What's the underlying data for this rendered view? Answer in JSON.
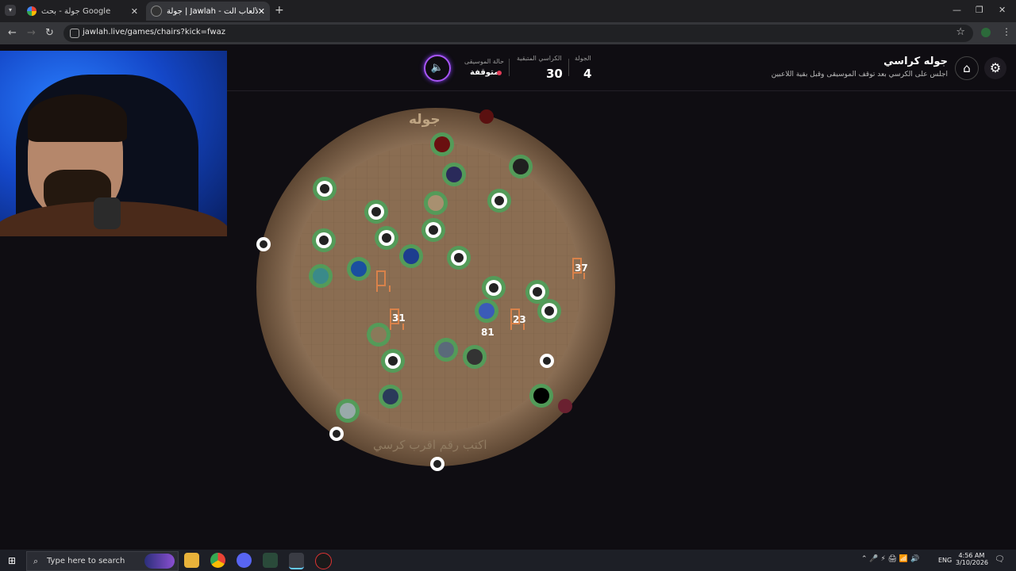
{
  "browser": {
    "tabs": [
      {
        "title": "جولة - بحث Google",
        "active": false
      },
      {
        "title": "جولة | Jawlah - منصة الألعاب الت...",
        "active": true
      }
    ],
    "url": "jawlah.live/games/chairs?kick=fwaz"
  },
  "header": {
    "title": "جوله كراسي",
    "subtitle": "اجلس على الكرسي بعد توقف الموسيقى وقبل بقية اللاعبين",
    "round_label": "الجولة",
    "round_value": "4",
    "remaining_label": "الكراسي المتبقية",
    "remaining_value": "30",
    "music_label": "حالة الموسيقى",
    "music_value": "متوقفة"
  },
  "board": {
    "title": "جوله",
    "prompt": "اكتب رقم اقرب كرسي",
    "chair_numbers": [
      "37",
      "31",
      "23",
      "81"
    ]
  },
  "taskbar": {
    "search_placeholder": "Type here to search",
    "lang": "ENG",
    "time": "4:56 AM",
    "date": "3/10/2026"
  },
  "colors": {
    "accent": "#a855f7",
    "status_stopped": "#e23b57",
    "board": "#8c7055",
    "player_ring": "#4aa35a"
  }
}
